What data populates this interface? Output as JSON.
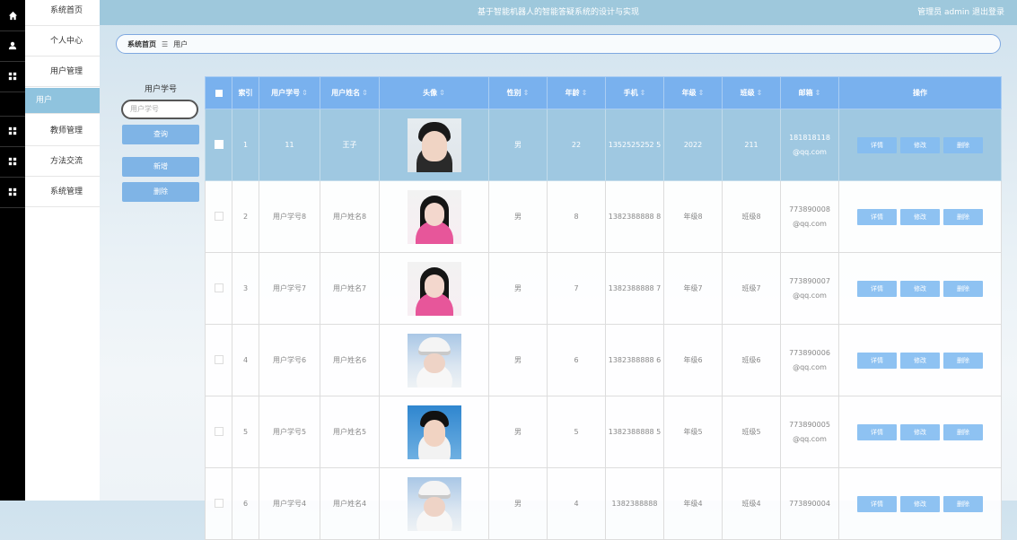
{
  "header": {
    "title": "基于智能机器人的智能答疑系统的设计与实现",
    "user_text": "管理员 admin  退出登录"
  },
  "menu": [
    {
      "label": "系统首页",
      "icon": "home-icon"
    },
    {
      "label": "个人中心",
      "icon": "person-icon"
    },
    {
      "label": "用户管理",
      "icon": "grid-icon"
    },
    {
      "label": "用户",
      "icon": ""
    },
    {
      "label": "教师管理",
      "icon": "grid-icon"
    },
    {
      "label": "方法交流",
      "icon": "grid-icon"
    },
    {
      "label": "系统管理",
      "icon": "grid-icon"
    }
  ],
  "breadcrumb": {
    "home": "系统首页",
    "sep": "☰",
    "current": "用户"
  },
  "search": {
    "label": "用户学号",
    "placeholder": "用户学号",
    "query_btn": "查询",
    "add_btn": "新增",
    "delete_btn": "删除"
  },
  "table": {
    "columns": [
      "索引",
      "用户学号",
      "用户姓名",
      "头像",
      "性别",
      "年龄",
      "手机",
      "年级",
      "班级",
      "邮箱",
      "操作"
    ],
    "sort_mark": "⇕",
    "actions": [
      "详情",
      "修改",
      "删除"
    ],
    "rows": [
      {
        "idx": "1",
        "no": "11",
        "name": "王子",
        "gender": "男",
        "age": "22",
        "phone": "1352525252 5",
        "grade": "2022",
        "cls": "211",
        "email": "181818118 @qq.com",
        "avatar": "boy"
      },
      {
        "idx": "2",
        "no": "用户学号8",
        "name": "用户姓名8",
        "gender": "男",
        "age": "8",
        "phone": "1382388888 8",
        "grade": "年级8",
        "cls": "班级8",
        "email": "773890008 @qq.com",
        "avatar": "girl"
      },
      {
        "idx": "3",
        "no": "用户学号7",
        "name": "用户姓名7",
        "gender": "男",
        "age": "7",
        "phone": "1382388888 7",
        "grade": "年级7",
        "cls": "班级7",
        "email": "773890007 @qq.com",
        "avatar": "girl"
      },
      {
        "idx": "4",
        "no": "用户学号6",
        "name": "用户姓名6",
        "gender": "男",
        "age": "6",
        "phone": "1382388888 6",
        "grade": "年级6",
        "cls": "班级6",
        "email": "773890006 @qq.com",
        "avatar": "hat"
      },
      {
        "idx": "5",
        "no": "用户学号5",
        "name": "用户姓名5",
        "gender": "男",
        "age": "5",
        "phone": "1382388888 5",
        "grade": "年级5",
        "cls": "班级5",
        "email": "773890005 @qq.com",
        "avatar": "blue"
      },
      {
        "idx": "6",
        "no": "用户学号4",
        "name": "用户姓名4",
        "gender": "男",
        "age": "4",
        "phone": "1382388888",
        "grade": "年级4",
        "cls": "班级4",
        "email": "773890004",
        "avatar": "hat"
      }
    ]
  },
  "colors": {
    "header": "#9ec8dc",
    "accent": "#79b1ee",
    "selected_row": "#9fc8e1",
    "button": "#8ec2f2"
  }
}
